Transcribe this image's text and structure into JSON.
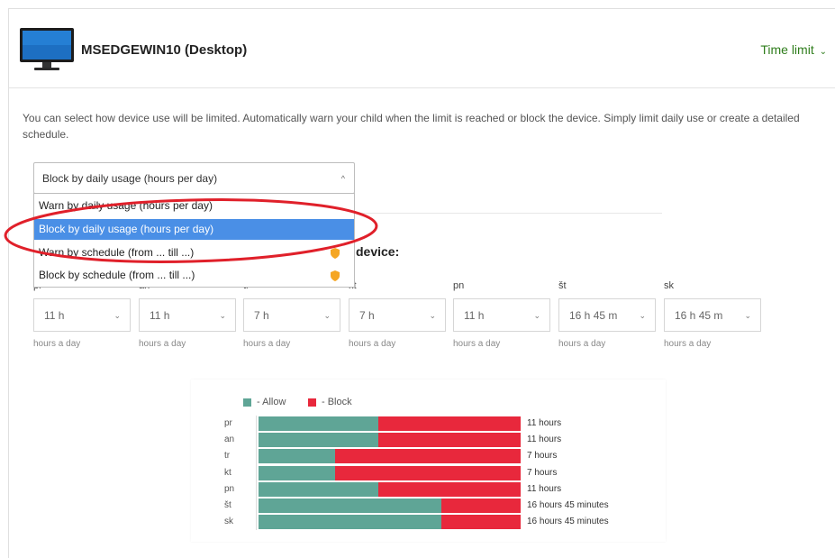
{
  "device": {
    "name": "MSEDGEWIN10 (Desktop)",
    "menu_label": "Time limit",
    "menu_chevron": "⌄"
  },
  "description": "You can select how device use will be limited. Automatically warn your child when the limit is reached or block the device. Simply limit daily use or create a detailed schedule.",
  "mode_select": {
    "value": "Block by daily usage (hours per day)",
    "caret": "^"
  },
  "dropdown_options": [
    {
      "label": "Warn by daily usage (hours per day)",
      "selected": false,
      "premium": false
    },
    {
      "label": "Block by daily usage (hours per day)",
      "selected": true,
      "premium": false
    },
    {
      "label": "Warn by schedule (from ... till ...)",
      "selected": false,
      "premium": true
    },
    {
      "label": "Block by schedule (from ... till ...)",
      "selected": false,
      "premium": true
    }
  ],
  "device_section_label": "device:",
  "days": [
    {
      "label": "pr",
      "value": "11 h",
      "hint": "hours a day"
    },
    {
      "label": "an",
      "value": "11 h",
      "hint": "hours a day"
    },
    {
      "label": "tr",
      "value": "7 h",
      "hint": "hours a day"
    },
    {
      "label": "kt",
      "value": "7 h",
      "hint": "hours a day"
    },
    {
      "label": "pn",
      "value": "11 h",
      "hint": "hours a day"
    },
    {
      "label": "št",
      "value": "16 h 45 m",
      "hint": "hours a day"
    },
    {
      "label": "sk",
      "value": "16 h 45 m",
      "hint": "hours a day"
    }
  ],
  "colors": {
    "allow": "#5fa596",
    "block": "#e8283c",
    "accent_green": "#2f7d1c",
    "selected_option": "#4a8fe6",
    "annotation_oval": "#e0202a",
    "premium_badge": "#f5a623"
  },
  "chart_data": {
    "type": "bar",
    "stacked": true,
    "orientation": "horizontal",
    "categories": [
      "pr",
      "an",
      "tr",
      "kt",
      "pn",
      "št",
      "sk"
    ],
    "series": [
      {
        "name": "- Allow",
        "values": [
          11,
          11,
          7,
          7,
          11,
          16.75,
          16.75
        ]
      },
      {
        "name": "- Block",
        "values": [
          13,
          13,
          17,
          17,
          13,
          7.25,
          7.25
        ]
      }
    ],
    "value_labels": [
      "11 hours",
      "11 hours",
      "7 hours",
      "7 hours",
      "11 hours",
      "16 hours 45 minutes",
      "16 hours 45 minutes"
    ],
    "xlim": [
      0,
      24
    ],
    "legend": "top-left",
    "grid": false
  }
}
